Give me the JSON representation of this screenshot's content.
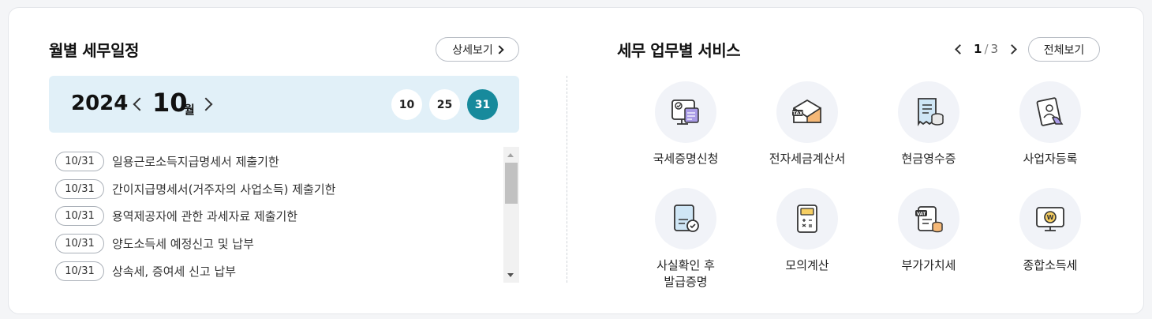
{
  "schedule": {
    "title": "월별 세무일정",
    "detail_label": "상세보기",
    "year": "2024",
    "month": "10",
    "month_unit": "월",
    "days": [
      "10",
      "25",
      "31"
    ],
    "selected_day": "31",
    "items": [
      {
        "date": "10/31",
        "text": "일용근로소득지급명세서 제출기한"
      },
      {
        "date": "10/31",
        "text": "간이지급명세서(거주자의 사업소득) 제출기한"
      },
      {
        "date": "10/31",
        "text": "용역제공자에 관한 과세자료 제출기한"
      },
      {
        "date": "10/31",
        "text": "양도소득세 예정신고 및 납부"
      },
      {
        "date": "10/31",
        "text": "상속세, 증여세 신고 납부"
      }
    ]
  },
  "services": {
    "title": "세무 업무별 서비스",
    "page_current": "1",
    "page_sep": "/",
    "page_total": "3",
    "all_label": "전체보기",
    "items": [
      {
        "label": "국세증명신청",
        "icon": "certificate-monitor-icon"
      },
      {
        "label": "전자세금계산서",
        "icon": "tax-envelope-icon"
      },
      {
        "label": "현금영수증",
        "icon": "receipt-coins-icon"
      },
      {
        "label": "사업자등록",
        "icon": "business-registration-icon"
      },
      {
        "label": "사실확인 후\n발급증명",
        "icon": "verified-document-icon"
      },
      {
        "label": "모의계산",
        "icon": "calculator-icon"
      },
      {
        "label": "부가가치세",
        "icon": "vat-document-icon"
      },
      {
        "label": "종합소득세",
        "icon": "income-tax-monitor-icon"
      }
    ]
  },
  "colors": {
    "accent": "#178a9c",
    "month_bar": "#e1f0f8",
    "icon_bg": "#f1f3f8"
  }
}
